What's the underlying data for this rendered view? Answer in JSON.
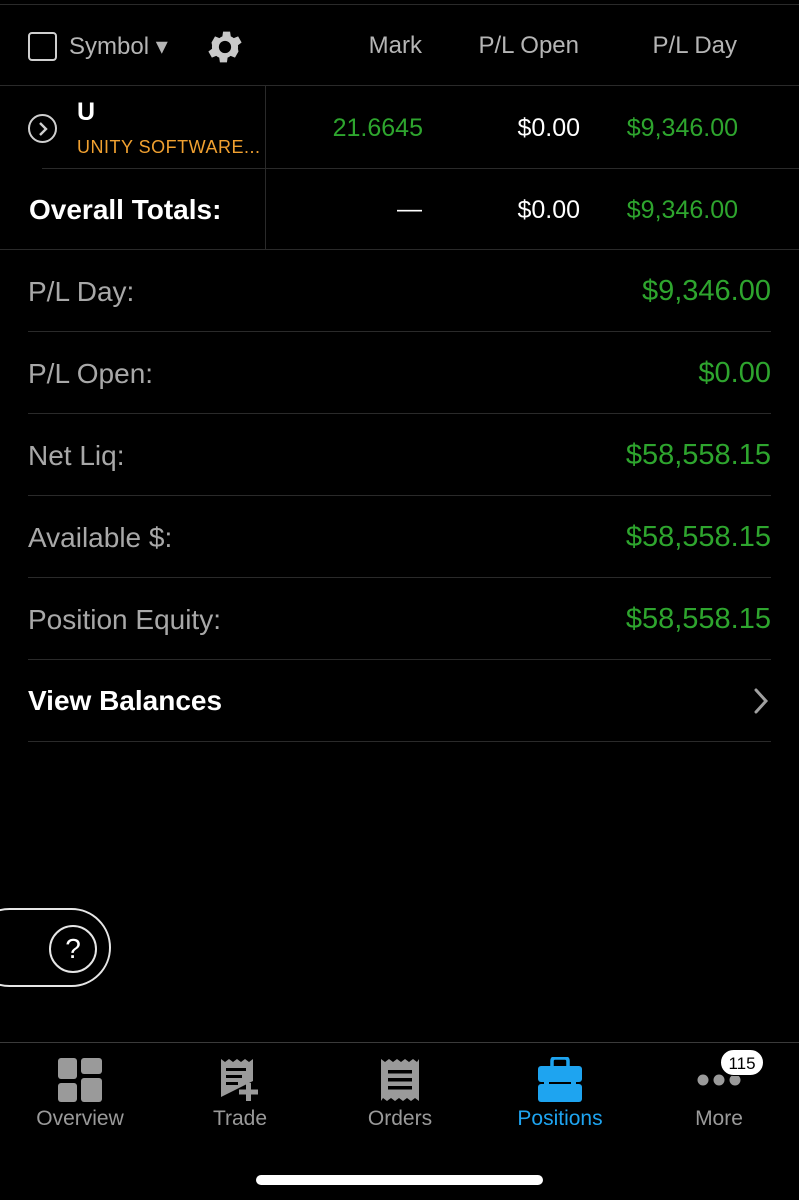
{
  "header": {
    "symbol_label": "Symbol ▾",
    "columns": {
      "mark": "Mark",
      "pl_open": "P/L Open",
      "pl_day": "P/L Day"
    }
  },
  "position": {
    "symbol": "U",
    "description": "UNITY SOFTWARE...",
    "mark": "21.6645",
    "pl_open": "$0.00",
    "pl_day": "$9,346.00"
  },
  "totals": {
    "label": "Overall Totals:",
    "mark": "—",
    "pl_open": "$0.00",
    "pl_day": "$9,346.00"
  },
  "summary": [
    {
      "label": "P/L Day:",
      "value": "$9,346.00"
    },
    {
      "label": "P/L Open:",
      "value": "$0.00"
    },
    {
      "label": "Net Liq:",
      "value": "$58,558.15"
    },
    {
      "label": "Available $:",
      "value": "$58,558.15"
    },
    {
      "label": "Position Equity:",
      "value": "$58,558.15"
    }
  ],
  "view_balances": {
    "label": "View Balances"
  },
  "help": {
    "glyph": "?"
  },
  "tabs": [
    {
      "label": "Overview",
      "icon": "overview-icon"
    },
    {
      "label": "Trade",
      "icon": "trade-icon"
    },
    {
      "label": "Orders",
      "icon": "orders-icon"
    },
    {
      "label": "Positions",
      "icon": "briefcase-icon",
      "active": true
    },
    {
      "label": "More",
      "icon": "more-icon"
    }
  ],
  "more_badge": "115",
  "colors": {
    "positive": "#2ea52e",
    "symbol_desc": "#f0a030",
    "active_tab": "#1ea4f0"
  }
}
